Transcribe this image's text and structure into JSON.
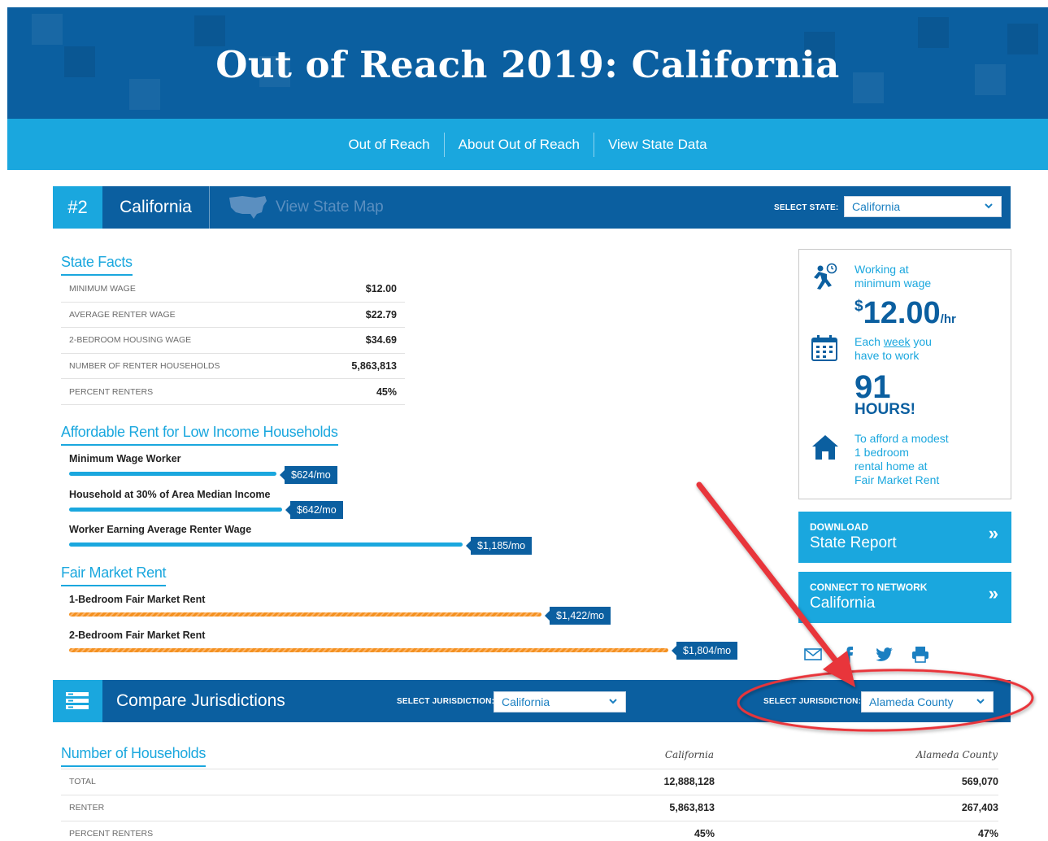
{
  "header": {
    "title": "Out of Reach 2019: California",
    "nav": [
      "Out of Reach",
      "About Out of Reach",
      "View State Data"
    ]
  },
  "state_bar": {
    "rank": "#2",
    "state": "California",
    "map_link": "View State Map",
    "select_label": "SELECT STATE:",
    "selected_state": "California"
  },
  "state_facts": {
    "title": "State Facts",
    "rows": [
      {
        "label": "MINIMUM WAGE",
        "value": "$12.00"
      },
      {
        "label": "AVERAGE RENTER WAGE",
        "value": "$22.79"
      },
      {
        "label": "2-BEDROOM HOUSING WAGE",
        "value": "$34.69"
      },
      {
        "label": "NUMBER OF RENTER HOUSEHOLDS",
        "value": "5,863,813"
      },
      {
        "label": "PERCENT RENTERS",
        "value": "45%"
      }
    ]
  },
  "affordable_rent": {
    "title": "Affordable Rent for Low Income Households",
    "bars": [
      {
        "label": "Minimum Wage Worker",
        "value": 624,
        "tag": "$624/mo"
      },
      {
        "label": "Household at 30% of Area Median Income",
        "value": 642,
        "tag": "$642/mo"
      },
      {
        "label": "Worker Earning Average Renter Wage",
        "value": 1185,
        "tag": "$1,185/mo"
      }
    ]
  },
  "fair_market_rent": {
    "title": "Fair Market Rent",
    "bars": [
      {
        "label": "1-Bedroom Fair Market Rent",
        "value": 1422,
        "tag": "$1,422/mo"
      },
      {
        "label": "2-Bedroom Fair Market Rent",
        "value": 1804,
        "tag": "$1,804/mo"
      }
    ]
  },
  "info_box": {
    "working_line1": "Working at",
    "working_line2": "minimum wage",
    "wage_sup": "$",
    "wage_value": "12.00",
    "wage_unit": "/hr",
    "each_prefix": "Each ",
    "each_link": "week",
    "each_suffix": " you",
    "each_line2": "have to work",
    "hours_value": "91",
    "hours_label": "HOURS!",
    "afford_lines": [
      "To afford a modest",
      "1 bedroom",
      "rental home at",
      "Fair Market Rent"
    ]
  },
  "cta": [
    {
      "small": "DOWNLOAD",
      "large": "State Report",
      "arrows": "»"
    },
    {
      "small": "CONNECT TO NETWORK",
      "large": "California",
      "arrows": "»"
    }
  ],
  "compare": {
    "title": "Compare Jurisdictions",
    "select_label_1": "SELECT JURISDICTION:",
    "selected_1": "California",
    "select_label_2": "SELECT JURISDICTION:",
    "selected_2": "Alameda County"
  },
  "households": {
    "title": "Number of Households",
    "col1": "California",
    "col2": "Alameda County",
    "rows": [
      {
        "label": "TOTAL",
        "v1": "12,888,128",
        "v2": "569,070"
      },
      {
        "label": "RENTER",
        "v1": "5,863,813",
        "v2": "267,403"
      },
      {
        "label": "PERCENT RENTERS",
        "v1": "45%",
        "v2": "47%"
      }
    ]
  },
  "colors": {
    "navy": "#0b5fa0",
    "sky": "#1aa7de",
    "orange": "#f49120",
    "annotation_red": "#e8343a"
  }
}
